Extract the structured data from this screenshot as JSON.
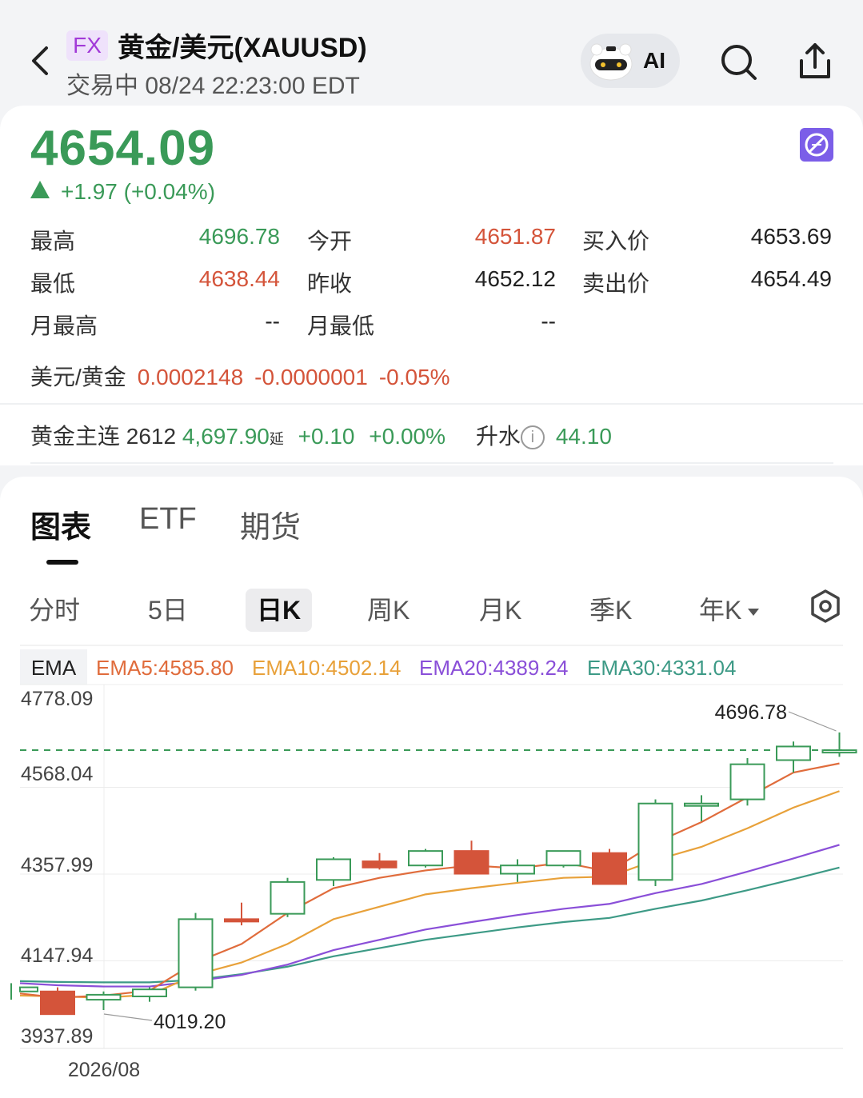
{
  "header": {
    "badge": "FX",
    "title": "黄金/美元(XAUUSD)",
    "subtitle": "交易中 08/24 22:23:00 EDT",
    "ai_label": "AI"
  },
  "quote": {
    "price": "4654.09",
    "change": "+1.97 (+0.04%)",
    "stats": {
      "high_label": "最高",
      "high": "4696.78",
      "open_label": "今开",
      "open": "4651.87",
      "bid_label": "买入价",
      "bid": "4653.69",
      "low_label": "最低",
      "low": "4638.44",
      "prev_label": "昨收",
      "prev": "4652.12",
      "ask_label": "卖出价",
      "ask": "4654.49",
      "mhigh_label": "月最高",
      "mhigh": "--",
      "mlow_label": "月最低",
      "mlow": "--"
    },
    "usd_gold": {
      "label": "美元/黄金",
      "value": "0.0002148",
      "change": "-0.0000001",
      "pct": "-0.05%"
    },
    "futures": {
      "label": "黄金主连 2612",
      "price": "4,697.90",
      "delay": "延",
      "change": "+0.10",
      "pct": "+0.00%",
      "premium_label": "升水",
      "premium": "44.10"
    }
  },
  "tabs": [
    "图表",
    "ETF",
    "期货"
  ],
  "periods": [
    "分时",
    "5日",
    "日K",
    "周K",
    "月K",
    "季K",
    "年K"
  ],
  "colors": {
    "up": "#3a9a58",
    "down": "#d4543a",
    "ema5": "#e06c3c",
    "ema10": "#e8a13a",
    "ema20": "#8a4fd8",
    "ema30": "#3d9a86"
  },
  "chart_data": {
    "type": "candlestick",
    "indicator_label": "EMA",
    "legend": [
      {
        "name": "EMA5",
        "value": "4585.80"
      },
      {
        "name": "EMA10",
        "value": "4502.14"
      },
      {
        "name": "EMA20",
        "value": "4389.24"
      },
      {
        "name": "EMA30",
        "value": "4331.04"
      }
    ],
    "y_ticks": [
      "4778.09",
      "4568.04",
      "4357.99",
      "4147.94",
      "3937.89"
    ],
    "ylim": [
      3937.89,
      4778.09
    ],
    "x_label": "2026/08",
    "current_price": 4654.09,
    "max_label": "4696.78",
    "min_label": "4019.20",
    "candles": [
      {
        "o": 4070,
        "h": 4090,
        "l": 4050,
        "c": 4080
      },
      {
        "o": 4070,
        "h": 4080,
        "l": 4020,
        "c": 4015
      },
      {
        "o": 4050,
        "h": 4070,
        "l": 4025,
        "c": 4062
      },
      {
        "o": 4058,
        "h": 4080,
        "l": 4045,
        "c": 4075
      },
      {
        "o": 4080,
        "h": 4260,
        "l": 4072,
        "c": 4245
      },
      {
        "o": 4245,
        "h": 4285,
        "l": 4230,
        "c": 4240
      },
      {
        "o": 4258,
        "h": 4345,
        "l": 4250,
        "c": 4335
      },
      {
        "o": 4340,
        "h": 4395,
        "l": 4325,
        "c": 4390
      },
      {
        "o": 4385,
        "h": 4405,
        "l": 4365,
        "c": 4370
      },
      {
        "o": 4375,
        "h": 4415,
        "l": 4370,
        "c": 4410
      },
      {
        "o": 4410,
        "h": 4435,
        "l": 4355,
        "c": 4355
      },
      {
        "o": 4355,
        "h": 4390,
        "l": 4335,
        "c": 4375
      },
      {
        "o": 4375,
        "h": 4410,
        "l": 4370,
        "c": 4410
      },
      {
        "o": 4405,
        "h": 4415,
        "l": 4330,
        "c": 4330
      },
      {
        "o": 4340,
        "h": 4535,
        "l": 4325,
        "c": 4525
      },
      {
        "o": 4525,
        "h": 4545,
        "l": 4482,
        "c": 4525
      },
      {
        "o": 4535,
        "h": 4635,
        "l": 4520,
        "c": 4620
      },
      {
        "o": 4630,
        "h": 4675,
        "l": 4600,
        "c": 4663
      },
      {
        "o": 4652,
        "h": 4697,
        "l": 4638,
        "c": 4654
      }
    ],
    "ema5": [
      4065,
      4055,
      4060,
      4072,
      4140,
      4185,
      4260,
      4320,
      4345,
      4363,
      4375,
      4368,
      4382,
      4360,
      4430,
      4480,
      4540,
      4600,
      4622
    ],
    "ema10": [
      4060,
      4058,
      4055,
      4062,
      4110,
      4140,
      4185,
      4245,
      4275,
      4305,
      4320,
      4333,
      4345,
      4348,
      4388,
      4420,
      4465,
      4515,
      4555
    ],
    "ema20": [
      4090,
      4085,
      4082,
      4082,
      4095,
      4110,
      4135,
      4170,
      4195,
      4220,
      4238,
      4255,
      4270,
      4282,
      4308,
      4330,
      4360,
      4392,
      4425
    ],
    "ema30": [
      4095,
      4093,
      4092,
      4092,
      4098,
      4112,
      4130,
      4155,
      4175,
      4195,
      4210,
      4225,
      4238,
      4248,
      4270,
      4290,
      4315,
      4342,
      4370
    ]
  }
}
